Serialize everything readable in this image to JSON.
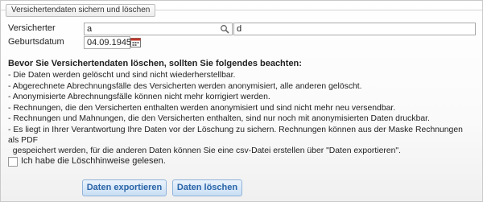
{
  "panel": {
    "title": "Versichertendaten sichern und löschen"
  },
  "form": {
    "insured_label": "Versicherter",
    "insured_value": "a",
    "insured_second_value": "d",
    "birth_label": "Geburtsdatum",
    "birth_value": "04.09.1945"
  },
  "notice": {
    "title": "Bevor Sie Versichertendaten löschen, sollten Sie folgendes beachten:",
    "items": [
      "- Die Daten werden gelöscht und sind nicht wiederherstellbar.",
      "- Abgerechnete Abrechnungsfälle des Versicherten werden anonymisiert, alle anderen gelöscht.",
      "- Anonymisierte Abrechnungsfälle können nicht mehr korrigiert werden.",
      "- Rechnungen, die den Versicherten enthalten werden anonymisiert und sind nicht mehr neu versendbar.",
      "- Rechnungen und Mahnungen, die den Versicherten enthalten, sind nur noch mit anonymisierten Daten druckbar.",
      "- Es liegt in Ihrer Verantwortung Ihre Daten vor der Löschung zu sichern. Rechnungen können aus der Maske Rechnungen als PDF\n  gespeichert werden, für die anderen Daten können Sie eine csv-Datei erstellen über \"Daten exportieren\"."
    ]
  },
  "confirm": {
    "label": "Ich habe die Löschhinweise gelesen.",
    "checked": false
  },
  "buttons": {
    "export": "Daten exportieren",
    "delete": "Daten löschen"
  },
  "icons": {
    "search": "search-icon",
    "calendar": "calendar-icon"
  }
}
